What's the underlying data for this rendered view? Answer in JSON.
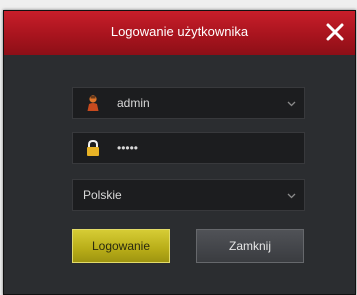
{
  "dialog": {
    "title": "Logowanie użytkownika",
    "close_icon": "close-icon"
  },
  "username": {
    "value": "admin",
    "icon": "user-icon"
  },
  "password": {
    "value": "•••••",
    "icon": "lock-icon"
  },
  "language": {
    "selected": "Polskie"
  },
  "buttons": {
    "login_label": "Logowanie",
    "cancel_label": "Zamknij"
  },
  "colors": {
    "titlebar": "#b0151f",
    "dialog_bg": "#2b2d30",
    "login_button": "#c2b820"
  }
}
